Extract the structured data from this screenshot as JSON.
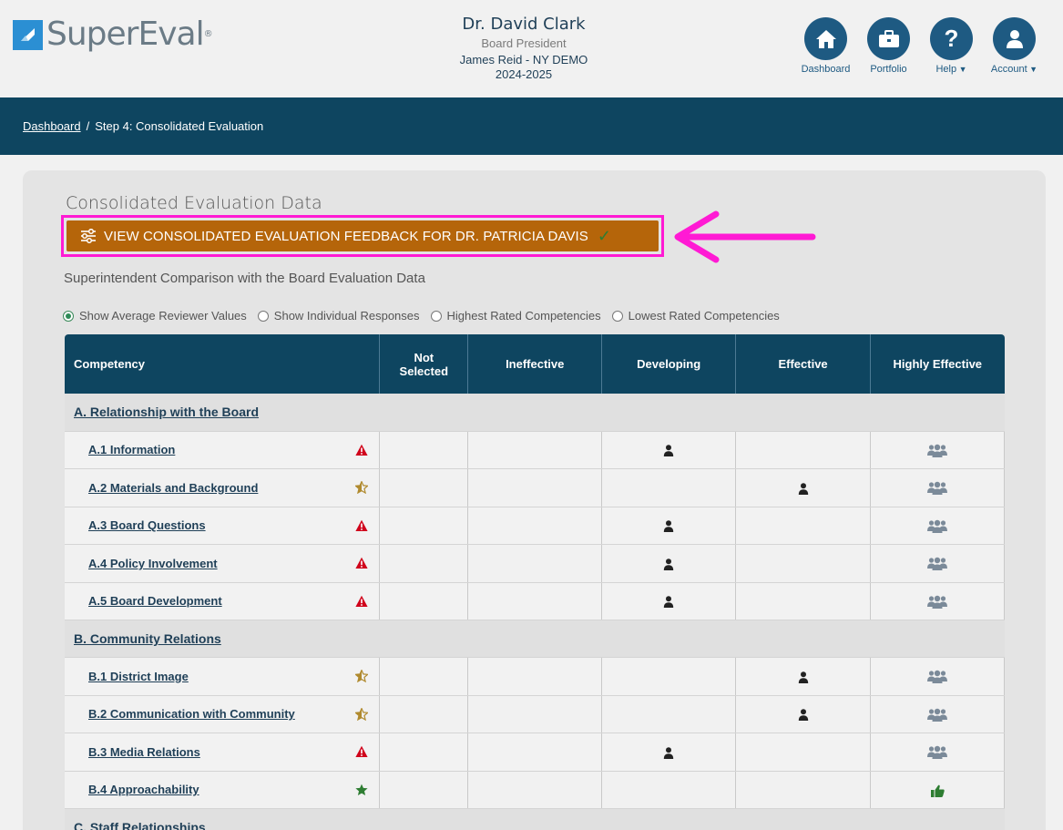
{
  "app": {
    "logo_text": "SuperEval",
    "logo_mark": "®"
  },
  "header": {
    "name": "Dr. David Clark",
    "role": "Board President",
    "district": "James Reid - NY DEMO",
    "year": "2024-2025"
  },
  "nav": {
    "dashboard": "Dashboard",
    "portfolio": "Portfolio",
    "help": "Help",
    "account": "Account"
  },
  "breadcrumb": {
    "home": "Dashboard",
    "separator": "/",
    "current": "Step 4: Consolidated Evaluation"
  },
  "main": {
    "title": "Consolidated Evaluation Data",
    "feedback_button": "VIEW CONSOLIDATED EVALUATION FEEDBACK FOR DR. PATRICIA DAVIS",
    "subtitle": "Superintendent Comparison with the Board Evaluation Data",
    "radios": [
      {
        "label": "Show Average Reviewer Values",
        "selected": true
      },
      {
        "label": "Show Individual Responses",
        "selected": false
      },
      {
        "label": "Highest Rated Competencies",
        "selected": false
      },
      {
        "label": "Lowest Rated Competencies",
        "selected": false
      }
    ]
  },
  "table": {
    "headers": {
      "competency": "Competency",
      "not_selected_1": "Not",
      "not_selected_2": "Selected",
      "ineffective": "Ineffective",
      "developing": "Developing",
      "effective": "Effective",
      "highly_effective": "Highly Effective"
    },
    "groups": [
      {
        "label": "A. Relationship with the Board",
        "rows": [
          {
            "label": "A.1 Information",
            "flag": "warning",
            "self": "Developing",
            "board": "Highly Effective"
          },
          {
            "label": "A.2 Materials and Background",
            "flag": "half-star",
            "self": "Effective",
            "board": "Highly Effective"
          },
          {
            "label": "A.3 Board Questions",
            "flag": "warning",
            "self": "Developing",
            "board": "Highly Effective"
          },
          {
            "label": "A.4 Policy Involvement",
            "flag": "warning",
            "self": "Developing",
            "board": "Highly Effective"
          },
          {
            "label": "A.5 Board Development",
            "flag": "warning",
            "self": "Developing",
            "board": "Highly Effective"
          }
        ]
      },
      {
        "label": "B. Community Relations",
        "rows": [
          {
            "label": "B.1 District Image",
            "flag": "half-star",
            "self": "Effective",
            "board": "Highly Effective"
          },
          {
            "label": "B.2 Communication with Community",
            "flag": "half-star",
            "self": "Effective",
            "board": "Highly Effective"
          },
          {
            "label": "B.3 Media Relations",
            "flag": "warning",
            "self": "Developing",
            "board": "Highly Effective"
          },
          {
            "label": "B.4 Approachability",
            "flag": "star",
            "self": "Highly Effective",
            "board": "Highly Effective",
            "match": true
          }
        ]
      },
      {
        "label": "C. Staff Relationships",
        "rows": []
      }
    ]
  },
  "colors": {
    "navy": "#0e4560",
    "accent_orange": "#b5650a",
    "highlight_magenta": "#ff1ad4",
    "warning_red": "#d0021b",
    "star_gold": "#b08a2e",
    "star_green": "#2e7d32"
  }
}
